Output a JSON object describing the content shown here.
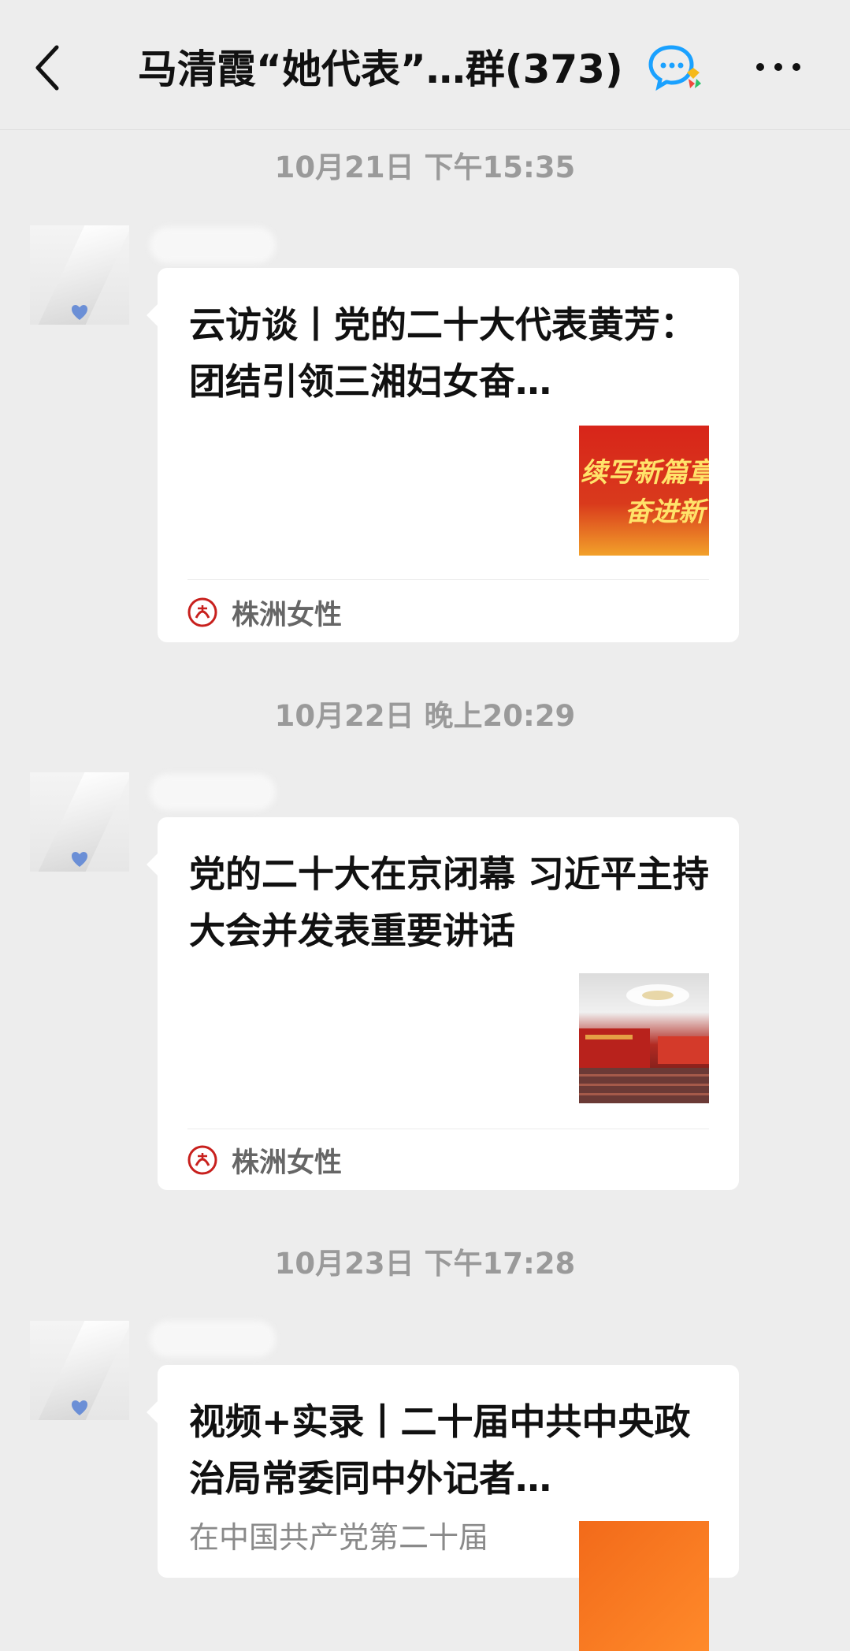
{
  "header": {
    "title": "马清霞“她代表”…群(373)",
    "icons": [
      "back-arrow-icon",
      "group-chat-icon",
      "more-icon"
    ]
  },
  "messages": [
    {
      "timestamp": "10月21日 下午15:35",
      "card": {
        "title": "云访谈丨党的二十大代表黄芳：团结引领三湘妇女奋…",
        "thumbnail_text_1": "续写新篇章",
        "thumbnail_text_2": "奋进新",
        "source": "株洲女性"
      }
    },
    {
      "timestamp": "10月22日 晚上20:29",
      "card": {
        "title": "党的二十大在京闭幕 习近平主持大会并发表重要讲话",
        "source": "株洲女性"
      }
    },
    {
      "timestamp": "10月23日 下午17:28",
      "card": {
        "title": "视频+实录丨二十届中共中央政治局常委同中外记者…",
        "description": "在中国共产党第二十届"
      }
    }
  ],
  "colors": {
    "background": "#ededed",
    "card": "#ffffff",
    "timestamp": "#9a9a9a",
    "title": "#111111",
    "source_text": "#666666",
    "logo_red": "#c8201d"
  }
}
